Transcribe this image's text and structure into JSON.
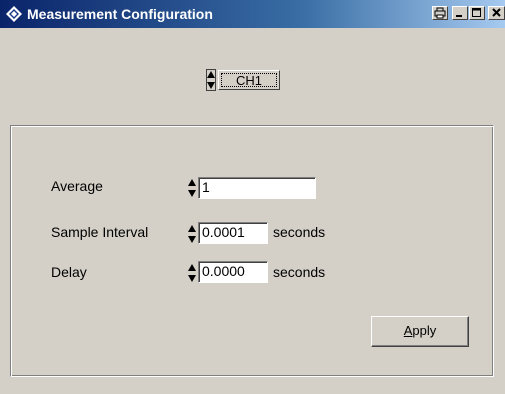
{
  "window": {
    "title": "Measurement Configuration",
    "controls": [
      "print-icon",
      "minimize-icon",
      "maximize-icon",
      "close-icon"
    ]
  },
  "channel": {
    "value": "CH1"
  },
  "form": {
    "average": {
      "label": "Average",
      "value": "1"
    },
    "sample_interval": {
      "label": "Sample Interval",
      "value": "0.0001",
      "unit": "seconds"
    },
    "delay": {
      "label": "Delay",
      "value": "0.0000",
      "unit": "seconds"
    }
  },
  "apply": {
    "accel": "A",
    "rest": "pply"
  },
  "colors": {
    "titlebar_start": "#0a246a",
    "titlebar_end": "#a6caf0",
    "face": "#d4d0c8"
  }
}
